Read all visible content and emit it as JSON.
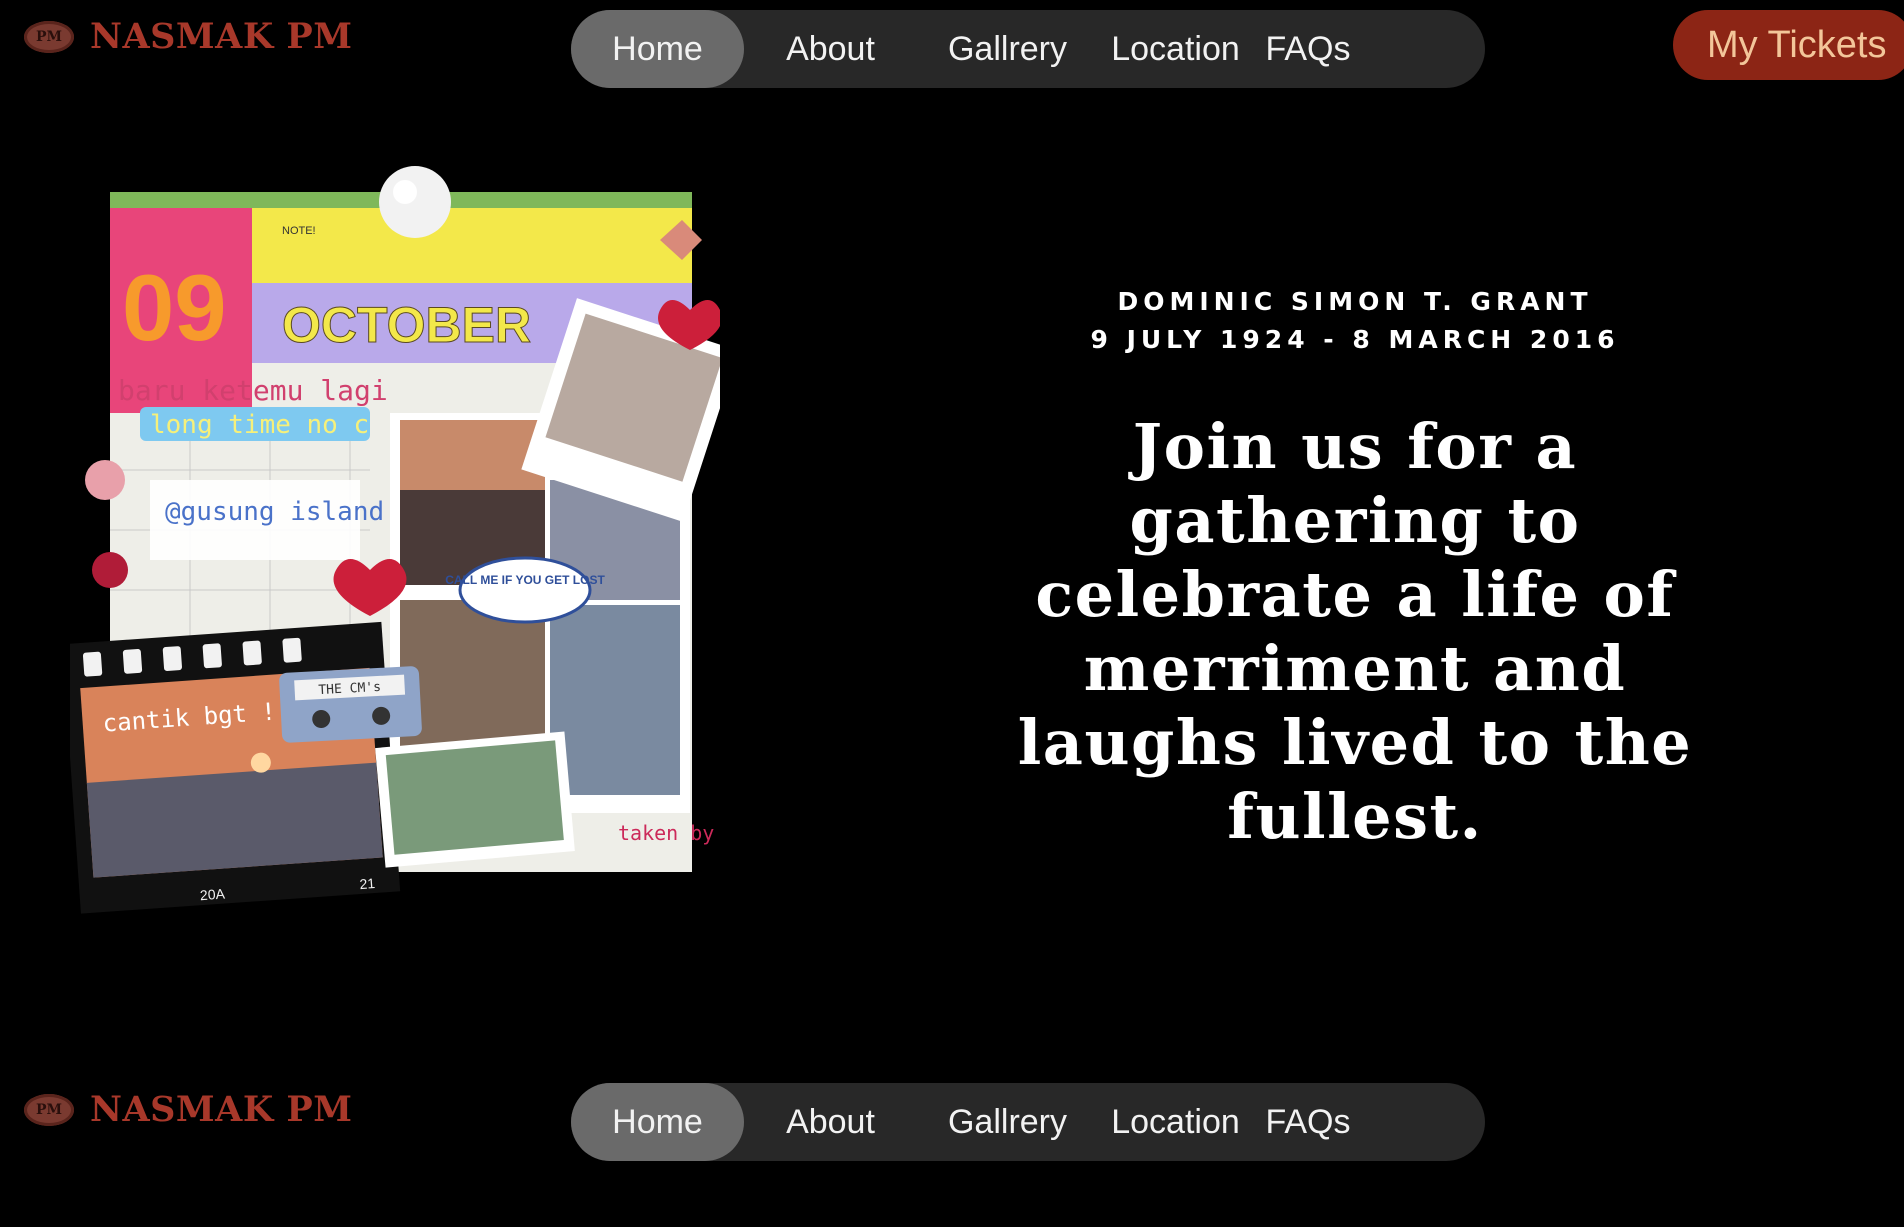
{
  "header": {
    "brand": {
      "logo_text": "PM",
      "name": "NASMAK PM"
    },
    "nav": [
      {
        "label": "Home",
        "active": true
      },
      {
        "label": "About",
        "active": false
      },
      {
        "label": "Gallrery",
        "active": false
      },
      {
        "label": "Location",
        "active": false
      },
      {
        "label": "FAQs",
        "active": false
      }
    ],
    "tickets_label": "My Tickets"
  },
  "hero": {
    "collage_texts": {
      "day": "09",
      "month": "OCTOBER",
      "note": "NOTE!",
      "line1": "baru ketemu lagi",
      "line2": "long time no c",
      "location": "@gusung island !",
      "sticker": "CALL ME IF YOU GET LOST",
      "tape": "THE CM's",
      "sunset": "cantik bgt !!",
      "credit": "taken by me :D",
      "film_code": "20A",
      "film_num": "21"
    },
    "name": "DOMINIC SIMON T. GRANT",
    "dates": "9 JULY 1924 - 8 MARCH 2016",
    "headline": "Join us for a gathering to celebrate a life of merriment and laughs lived to the fullest."
  },
  "footer": {
    "brand": {
      "logo_text": "PM",
      "name": "NASMAK PM"
    },
    "nav": [
      {
        "label": "Home",
        "active": true
      },
      {
        "label": "About",
        "active": false
      },
      {
        "label": "Gallrery",
        "active": false
      },
      {
        "label": "Location",
        "active": false
      },
      {
        "label": "FAQs",
        "active": false
      }
    ]
  },
  "colors": {
    "background": "#000000",
    "brand": "#a8382a",
    "nav_bg": "#282828",
    "nav_active": "#6a6a6a",
    "tickets_bg": "#8c2515",
    "tickets_text": "#f3c69a"
  }
}
